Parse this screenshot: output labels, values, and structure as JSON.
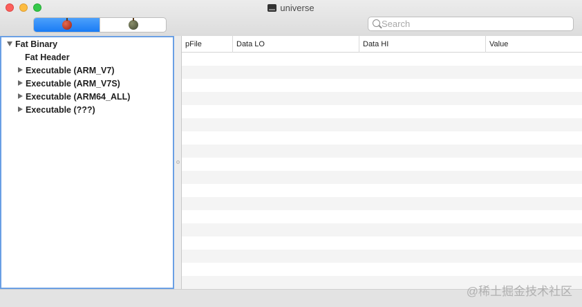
{
  "window": {
    "title": "universe"
  },
  "toolbar": {
    "segments": [
      {
        "icon": "red-apple-icon",
        "active": true
      },
      {
        "icon": "green-apple-icon",
        "active": false
      }
    ],
    "search": {
      "placeholder": "Search",
      "value": ""
    }
  },
  "tree": {
    "items": [
      {
        "label": "Fat Binary",
        "expanded": true
      },
      {
        "label": "Fat Header"
      },
      {
        "label": "Executable  (ARM_V7)",
        "expanded": false
      },
      {
        "label": "Executable  (ARM_V7S)",
        "expanded": false
      },
      {
        "label": "Executable  (ARM64_ALL)",
        "expanded": false
      },
      {
        "label": "Executable  (???)",
        "expanded": false
      }
    ]
  },
  "table": {
    "columns": [
      "pFile",
      "Data LO",
      "Data HI",
      "Value"
    ],
    "rows": []
  },
  "watermark": "@稀土掘金技术社区",
  "colors": {
    "accent": "#1a7cf5",
    "focus_ring": "#6a9fe4",
    "close": "#fc605c",
    "minimize": "#fdbc40",
    "maximize": "#34c84a"
  }
}
